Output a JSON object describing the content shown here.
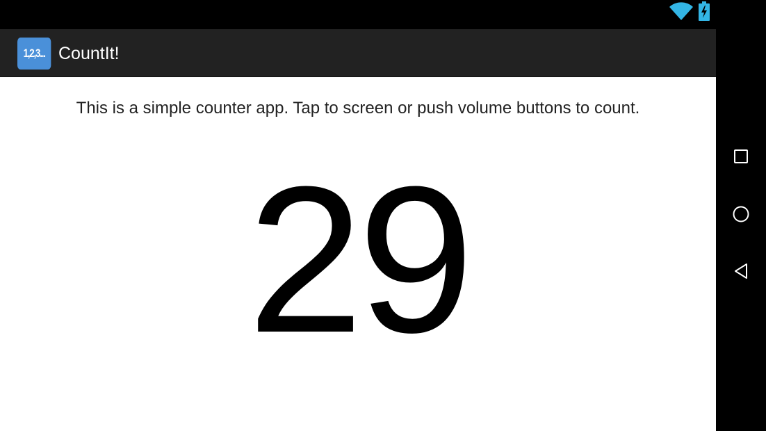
{
  "status_bar": {
    "icons": [
      "wifi-icon",
      "battery-charging-icon"
    ]
  },
  "action_bar": {
    "app_icon_text": "1,2,3...",
    "title": "CountIt!"
  },
  "main": {
    "instructions": "This is a simple counter app. Tap to screen or push volume buttons to count.",
    "count": "29"
  },
  "nav_bar": {
    "buttons": [
      "recents-icon",
      "home-icon",
      "back-icon"
    ]
  },
  "colors": {
    "accent": "#33b5e5",
    "app_icon_bg": "#4a90d9",
    "action_bar_bg": "#222222"
  }
}
